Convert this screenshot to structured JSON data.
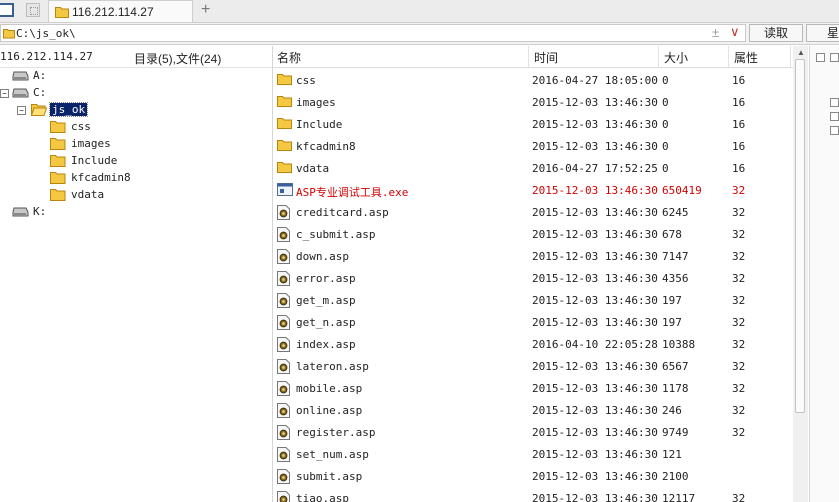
{
  "tab": {
    "title": "116.212.114.27",
    "add_icon": "plus-icon"
  },
  "toolbar": {
    "path": "C:\\js_ok\\",
    "clear_symbol": "±",
    "dropdown_symbol": "∨",
    "read_label": "读取",
    "cut_label": "星"
  },
  "tree": {
    "host": "116.212.114.27",
    "summary": "目录(5),文件(24)",
    "nodes": [
      {
        "label": "A:",
        "type": "drive",
        "expander": ""
      },
      {
        "label": "C:",
        "type": "drive",
        "expander": "⊟"
      },
      {
        "label": "js_ok",
        "type": "folder-open",
        "expander": "⊟",
        "selected": true
      },
      {
        "label": "css",
        "type": "folder"
      },
      {
        "label": "images",
        "type": "folder"
      },
      {
        "label": "Include",
        "type": "folder"
      },
      {
        "label": "kfcadmin8",
        "type": "folder"
      },
      {
        "label": "vdata",
        "type": "folder"
      },
      {
        "label": "K:",
        "type": "drive",
        "expander": ""
      }
    ]
  },
  "list": {
    "columns": {
      "name": "名称",
      "time": "时间",
      "size": "大小",
      "attr": "属性"
    },
    "rows": [
      {
        "name": "css",
        "time": "2016-04-27 18:05:00",
        "size": "0",
        "attr": "16",
        "type": "folder"
      },
      {
        "name": "images",
        "time": "2015-12-03 13:46:30",
        "size": "0",
        "attr": "16",
        "type": "folder"
      },
      {
        "name": "Include",
        "time": "2015-12-03 13:46:30",
        "size": "0",
        "attr": "16",
        "type": "folder"
      },
      {
        "name": "kfcadmin8",
        "time": "2015-12-03 13:46:30",
        "size": "0",
        "attr": "16",
        "type": "folder"
      },
      {
        "name": "vdata",
        "time": "2016-04-27 17:52:25",
        "size": "0",
        "attr": "16",
        "type": "folder"
      },
      {
        "name": "ASP专业调试工具.exe",
        "time": "2015-12-03 13:46:30",
        "size": "650419",
        "attr": "32",
        "type": "exe",
        "highlight": true
      },
      {
        "name": "creditcard.asp",
        "time": "2015-12-03 13:46:30",
        "size": "6245",
        "attr": "32",
        "type": "asp"
      },
      {
        "name": "c_submit.asp",
        "time": "2015-12-03 13:46:30",
        "size": "678",
        "attr": "32",
        "type": "asp"
      },
      {
        "name": "down.asp",
        "time": "2015-12-03 13:46:30",
        "size": "7147",
        "attr": "32",
        "type": "asp"
      },
      {
        "name": "error.asp",
        "time": "2015-12-03 13:46:30",
        "size": "4356",
        "attr": "32",
        "type": "asp"
      },
      {
        "name": "get_m.asp",
        "time": "2015-12-03 13:46:30",
        "size": "197",
        "attr": "32",
        "type": "asp"
      },
      {
        "name": "get_n.asp",
        "time": "2015-12-03 13:46:30",
        "size": "197",
        "attr": "32",
        "type": "asp"
      },
      {
        "name": "index.asp",
        "time": "2016-04-10 22:05:28",
        "size": "10388",
        "attr": "32",
        "type": "asp"
      },
      {
        "name": "lateron.asp",
        "time": "2015-12-03 13:46:30",
        "size": "6567",
        "attr": "32",
        "type": "asp"
      },
      {
        "name": "mobile.asp",
        "time": "2015-12-03 13:46:30",
        "size": "1178",
        "attr": "32",
        "type": "asp"
      },
      {
        "name": "online.asp",
        "time": "2015-12-03 13:46:30",
        "size": "246",
        "attr": "32",
        "type": "asp"
      },
      {
        "name": "register.asp",
        "time": "2015-12-03 13:46:30",
        "size": "9749",
        "attr": "32",
        "type": "asp"
      },
      {
        "name": "set_num.asp",
        "time": "2015-12-03 13:46:30",
        "size": "121",
        "attr": "",
        "type": "asp"
      },
      {
        "name": "submit.asp",
        "time": "2015-12-03 13:46:30",
        "size": "2100",
        "attr": "",
        "type": "asp"
      },
      {
        "name": "tiao.asp",
        "time": "2015-12-03 13:46:30",
        "size": "12117",
        "attr": "32",
        "type": "asp"
      }
    ]
  },
  "colors": {
    "selection_bg": "#0a246a",
    "highlight_text": "#d40000",
    "folder": "#f4c842"
  }
}
